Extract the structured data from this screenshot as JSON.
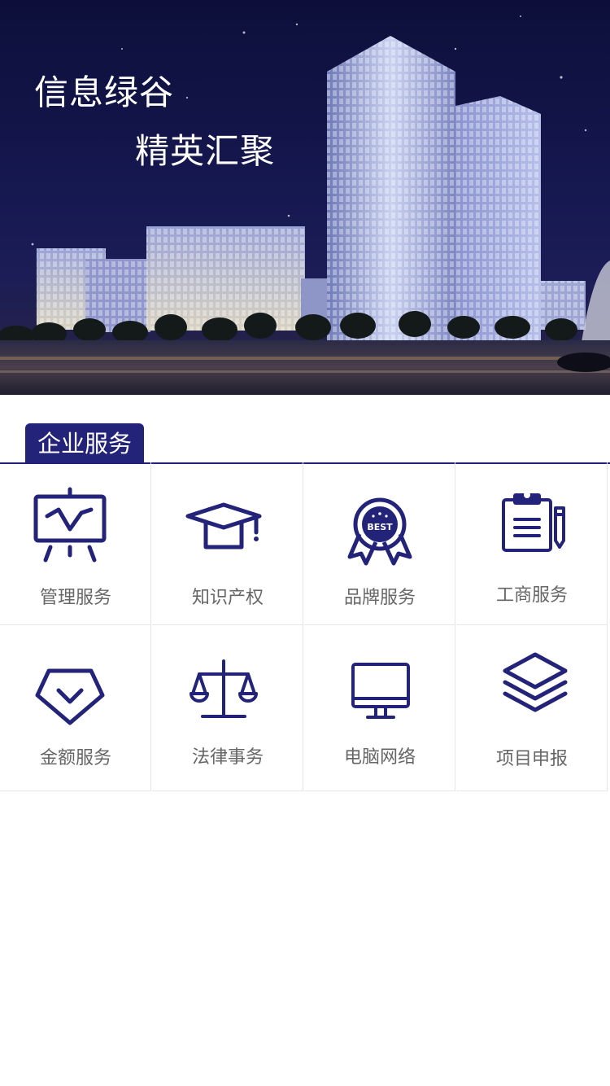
{
  "banner": {
    "line1": "信息绿谷",
    "line2": "精英汇聚"
  },
  "section": {
    "title": "企业服务"
  },
  "services": [
    {
      "label": "管理服务",
      "icon": "presentation-chart-icon"
    },
    {
      "label": "知识产权",
      "icon": "graduation-cap-icon"
    },
    {
      "label": "品牌服务",
      "icon": "best-award-badge-icon"
    },
    {
      "label": "工商服务",
      "icon": "clipboard-pencil-icon"
    },
    {
      "label": "金额服务",
      "icon": "diamond-icon"
    },
    {
      "label": "法律事务",
      "icon": "balance-scale-icon"
    },
    {
      "label": "电脑网络",
      "icon": "computer-monitor-icon"
    },
    {
      "label": "项目申报",
      "icon": "layers-icon"
    }
  ],
  "badge_text": "BEST",
  "colors": {
    "accent": "#23237a",
    "label": "#666666",
    "divider": "#e6e6e6"
  }
}
